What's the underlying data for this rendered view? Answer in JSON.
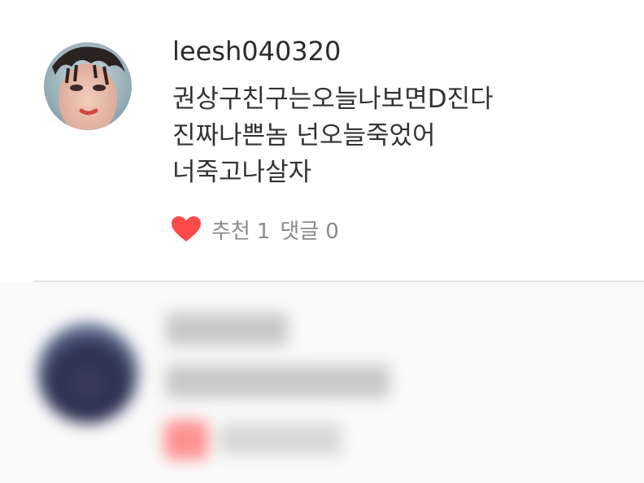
{
  "comment": {
    "username": "leesh040320",
    "lines": [
      "권상구친구는오늘나보면D진다",
      "진짜나쁜놈 넌오늘죽었어",
      "너죽고나살자"
    ],
    "like_label": "추천",
    "like_count": "1",
    "reply_label": "댓글",
    "reply_count": "0",
    "heart_color": "#ff4a4a",
    "avatar_icon": "user-photo"
  },
  "blurred_comment": {
    "heart_color": "#ff8f8f"
  }
}
